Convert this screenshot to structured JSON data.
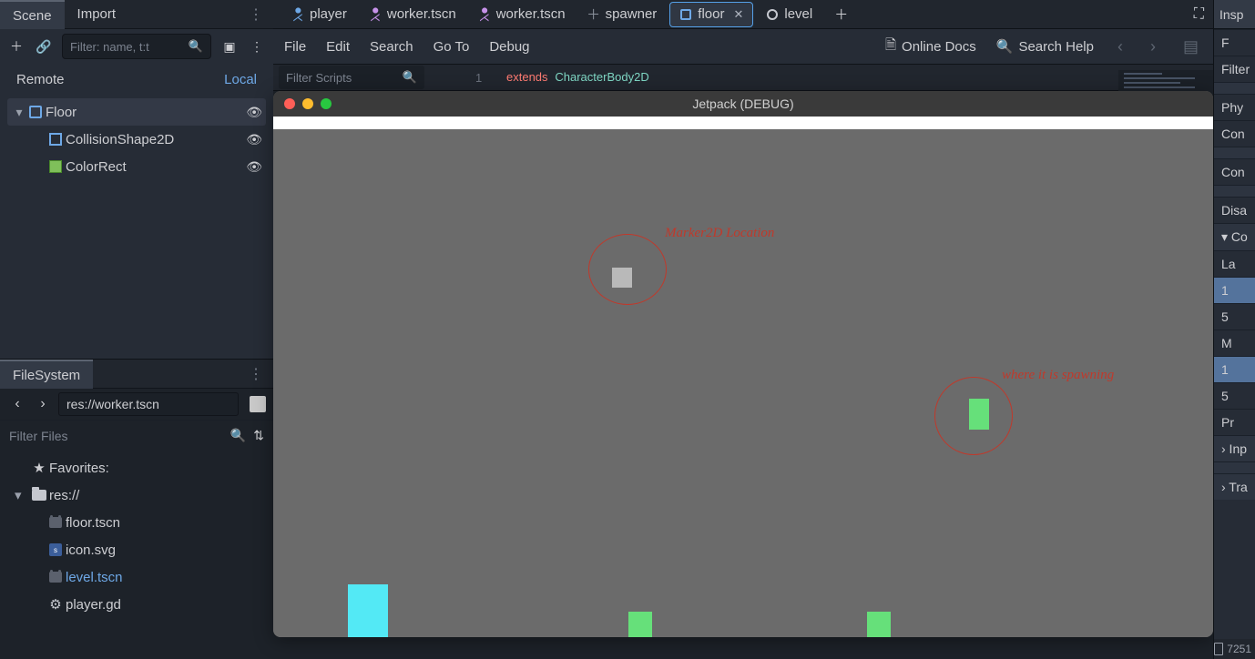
{
  "left": {
    "tabs": [
      "Scene",
      "Import"
    ],
    "scene_filter_ph": "Filter: name, t:t",
    "remote": "Remote",
    "local": "Local",
    "tree": [
      {
        "label": "Floor",
        "sel": true,
        "icon": "sq",
        "depth": 0,
        "eye": true,
        "chev": "▾"
      },
      {
        "label": "CollisionShape2D",
        "sel": false,
        "icon": "col",
        "depth": 1,
        "eye": true
      },
      {
        "label": "ColorRect",
        "sel": false,
        "icon": "rect",
        "depth": 1,
        "eye": true
      }
    ]
  },
  "filesystem": {
    "title": "FileSystem",
    "path": "res://worker.tscn",
    "filter_ph": "Filter Files",
    "rows": [
      {
        "icon": "star",
        "label": "Favorites:",
        "depth": 0
      },
      {
        "icon": "folder",
        "label": "res://",
        "depth": 0,
        "chev": "▾"
      },
      {
        "icon": "scene",
        "label": "floor.tscn",
        "depth": 1
      },
      {
        "icon": "svg",
        "label": "icon.svg",
        "depth": 1
      },
      {
        "icon": "scene",
        "label": "level.tscn",
        "depth": 1,
        "link": true
      },
      {
        "icon": "gear",
        "label": "player.gd",
        "depth": 1
      }
    ]
  },
  "center": {
    "tabs": [
      {
        "icon": "char-blue",
        "label": "player"
      },
      {
        "icon": "char",
        "label": "worker.tscn"
      },
      {
        "icon": "char",
        "label": "worker.tscn"
      },
      {
        "icon": "plus",
        "label": "spawner"
      },
      {
        "icon": "sq",
        "label": "floor",
        "active": true,
        "close": true
      },
      {
        "icon": "ring",
        "label": "level"
      }
    ],
    "menu": [
      "File",
      "Edit",
      "Search",
      "Go To",
      "Debug"
    ],
    "right_links": [
      {
        "icon": "doc",
        "label": "Online Docs"
      },
      {
        "icon": "search",
        "label": "Search Help"
      }
    ],
    "script_filter_ph": "Filter Scripts",
    "code_line": "1",
    "code_kw": "extends",
    "code_cls": "CharacterBody2D"
  },
  "game": {
    "title": "Jetpack (DEBUG)",
    "ann1": "Marker2D Location",
    "ann2": "where it is spawning"
  },
  "right": {
    "header": "Insp",
    "rows": [
      "F",
      "Filter",
      "",
      "Phy",
      "Con",
      "",
      "Con",
      "",
      "Disa",
      "Co",
      "La",
      "1",
      "5",
      "M",
      "1",
      "5",
      "Pr",
      "Inp",
      "",
      "Tra"
    ],
    "footer": "7251"
  }
}
